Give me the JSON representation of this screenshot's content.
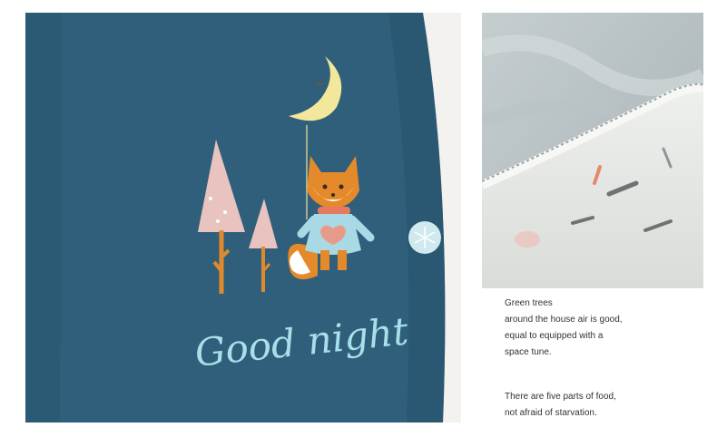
{
  "left_image": {
    "description_text": "Good night"
  },
  "captions": {
    "block1": [
      "Green trees",
      "around the house air is good,",
      "equal to equipped with a",
      "space tune."
    ],
    "block2": [
      "There are five parts of food,",
      "not afraid of starvation."
    ]
  },
  "colors": {
    "curtain": "#2f5f7a",
    "curtain_dark": "#264f67",
    "moon": "#f2e79a",
    "fox_orange": "#e58a2a",
    "sweater": "#a9d9e5",
    "tree": "#e8c3c0",
    "trunk": "#e08a2c",
    "script_text": "#a8e0ea",
    "caption_text": "#333333"
  }
}
